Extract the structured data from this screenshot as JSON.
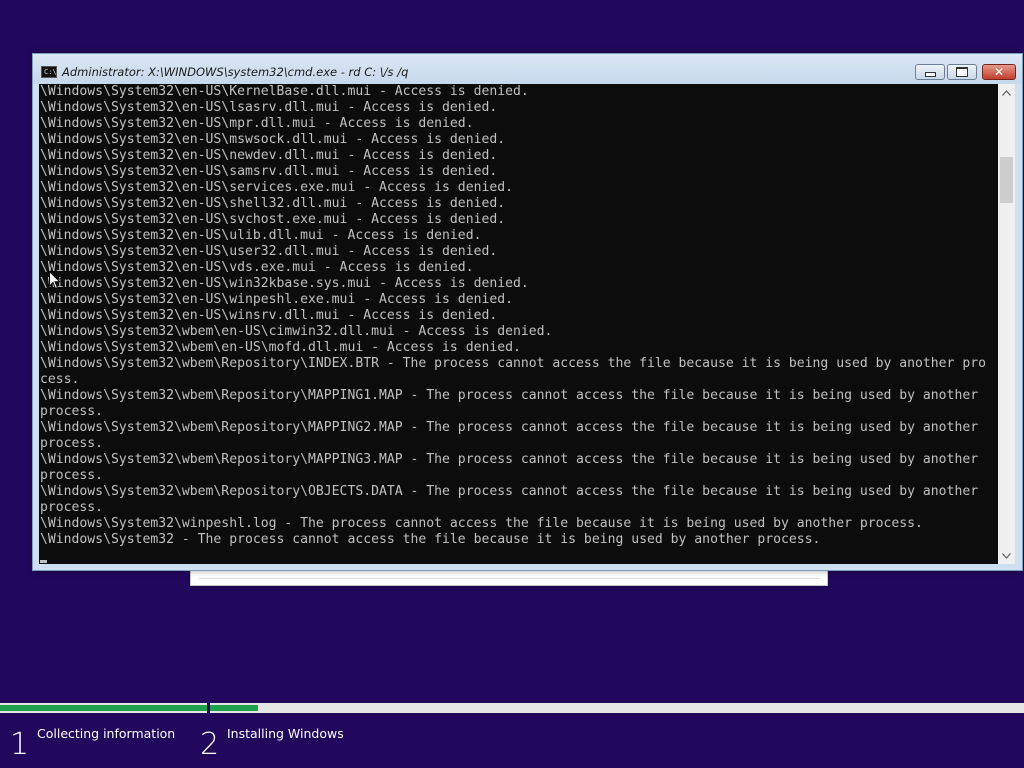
{
  "window": {
    "title": "Administrator: X:\\WINDOWS\\system32\\cmd.exe - rd  C: \\/s /q",
    "icon_label": "C:\\",
    "close_glyph": "✕"
  },
  "console": {
    "lines": [
      "\\Windows\\System32\\en-US\\KernelBase.dll.mui - Access is denied.",
      "\\Windows\\System32\\en-US\\lsasrv.dll.mui - Access is denied.",
      "\\Windows\\System32\\en-US\\mpr.dll.mui - Access is denied.",
      "\\Windows\\System32\\en-US\\mswsock.dll.mui - Access is denied.",
      "\\Windows\\System32\\en-US\\newdev.dll.mui - Access is denied.",
      "\\Windows\\System32\\en-US\\samsrv.dll.mui - Access is denied.",
      "\\Windows\\System32\\en-US\\services.exe.mui - Access is denied.",
      "\\Windows\\System32\\en-US\\shell32.dll.mui - Access is denied.",
      "\\Windows\\System32\\en-US\\svchost.exe.mui - Access is denied.",
      "\\Windows\\System32\\en-US\\ulib.dll.mui - Access is denied.",
      "\\Windows\\System32\\en-US\\user32.dll.mui - Access is denied.",
      "\\Windows\\System32\\en-US\\vds.exe.mui - Access is denied.",
      "\\Windows\\System32\\en-US\\win32kbase.sys.mui - Access is denied.",
      "\\Windows\\System32\\en-US\\winpeshl.exe.mui - Access is denied.",
      "\\Windows\\System32\\en-US\\winsrv.dll.mui - Access is denied.",
      "\\Windows\\System32\\wbem\\en-US\\cimwin32.dll.mui - Access is denied.",
      "\\Windows\\System32\\wbem\\en-US\\mofd.dll.mui - Access is denied.",
      "\\Windows\\System32\\wbem\\Repository\\INDEX.BTR - The process cannot access the file because it is being used by another pro",
      "cess.",
      "\\Windows\\System32\\wbem\\Repository\\MAPPING1.MAP - The process cannot access the file because it is being used by another",
      "process.",
      "\\Windows\\System32\\wbem\\Repository\\MAPPING2.MAP - The process cannot access the file because it is being used by another",
      "process.",
      "\\Windows\\System32\\wbem\\Repository\\MAPPING3.MAP - The process cannot access the file because it is being used by another",
      "process.",
      "\\Windows\\System32\\wbem\\Repository\\OBJECTS.DATA - The process cannot access the file because it is being used by another",
      "process.",
      "\\Windows\\System32\\winpeshl.log - The process cannot access the file because it is being used by another process.",
      "\\Windows\\System32 - The process cannot access the file because it is being used by another process."
    ]
  },
  "setup_progress": {
    "steps": [
      {
        "number": "1",
        "label": "Collecting information",
        "progress": 1.0
      },
      {
        "number": "2",
        "label": "Installing Windows",
        "progress": 0.06
      }
    ],
    "fill_color": "#1ba24a",
    "background_color": "#21085d"
  }
}
